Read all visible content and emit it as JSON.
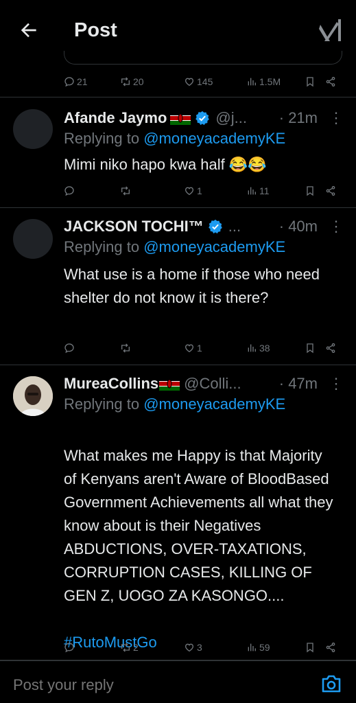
{
  "header": {
    "title": "Post"
  },
  "stub_actions": {
    "replies": "21",
    "reposts": "20",
    "likes": "145",
    "views": "1.5M"
  },
  "tweets": [
    {
      "name": "Afande Jaymo",
      "handle": "@j...",
      "time": "· 21m",
      "replying_label": "Replying to",
      "mention": "@moneyacademyKE",
      "text": "Mimi niko hapo kwa half 😂😂",
      "replies": "",
      "reposts": "",
      "likes": "1",
      "views": "11"
    },
    {
      "name": "JACKSON TOCHI™",
      "handle": "...",
      "time": "· 40m",
      "replying_label": "Replying to",
      "mention": "@moneyacademyKE",
      "text": "What use is a home if those who need shelter do not know it is there?",
      "replies": "",
      "reposts": "",
      "likes": "1",
      "views": "38"
    },
    {
      "name": "MureaCollins",
      "handle": "@Colli...",
      "time": "· 47m",
      "replying_label": "Replying to",
      "mention": "@moneyacademyKE",
      "text": "What makes me Happy is that Majority of Kenyans aren't Aware of BloodBased Government Achievements all what they know about is their Negatives ABDUCTIONS, OVER-TAXATIONS, CORRUPTION CASES, KILLING OF GEN Z, UOGO ZA KASONGO....",
      "hashtag": "#RutoMustGo",
      "replies": "",
      "reposts": "2",
      "likes": "3",
      "views": "59"
    }
  ],
  "composer": {
    "placeholder": "Post your reply"
  },
  "colors": {
    "accent": "#1d9bf0",
    "muted": "#71767b",
    "text": "#e7e9ea",
    "divider": "#2f3336",
    "background": "#000000"
  },
  "icons": [
    "back-arrow-icon",
    "xai-logo-icon",
    "reply-icon",
    "repost-icon",
    "like-icon",
    "views-icon",
    "bookmark-icon",
    "share-icon",
    "verified-icon",
    "kenya-flag-icon",
    "more-icon",
    "camera-icon"
  ]
}
